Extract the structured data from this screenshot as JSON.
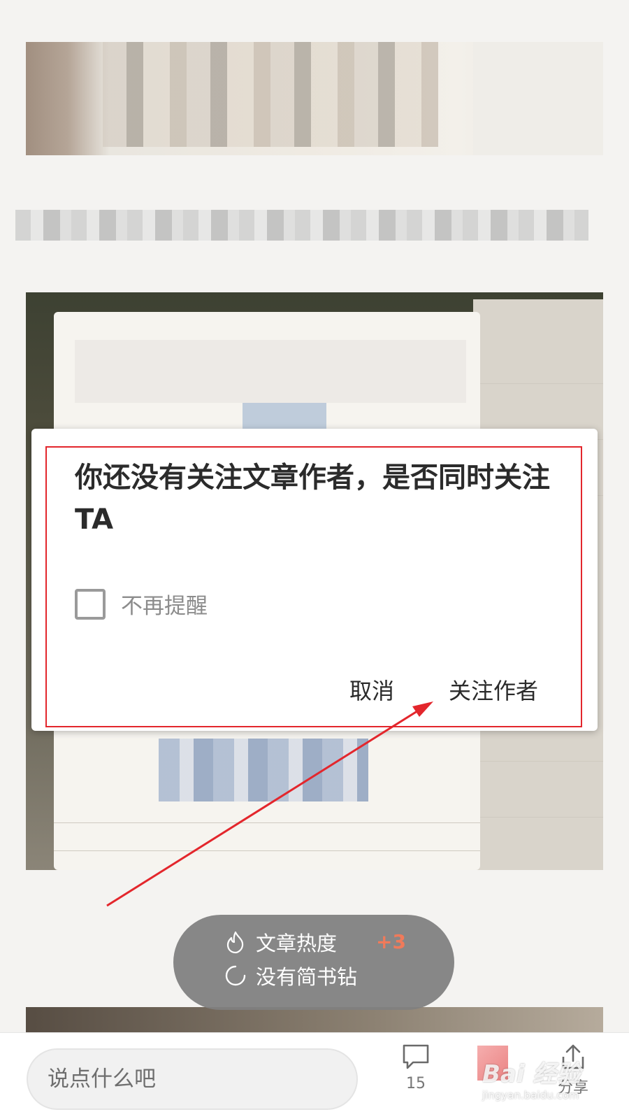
{
  "dialog": {
    "title": "你还没有关注文章作者，是否同时关注TA",
    "checkbox_label": "不再提醒",
    "checkbox_checked": false,
    "cancel_label": "取消",
    "confirm_label": "关注作者",
    "highlight_color": "#e3262c"
  },
  "toast": {
    "line1": "文章热度",
    "line1_badge": "+3",
    "line2": "没有简书钻",
    "line1_icon": "flame-icon",
    "line2_icon": "loading-circle-icon"
  },
  "bottom_bar": {
    "comment_placeholder": "说点什么吧",
    "comment_count": "15",
    "share_label": "分享",
    "icons": [
      "comment-icon",
      "like-icon",
      "share-icon"
    ]
  },
  "watermark": {
    "text": "Bai 经验",
    "url": "jingyan.baidu.com"
  }
}
